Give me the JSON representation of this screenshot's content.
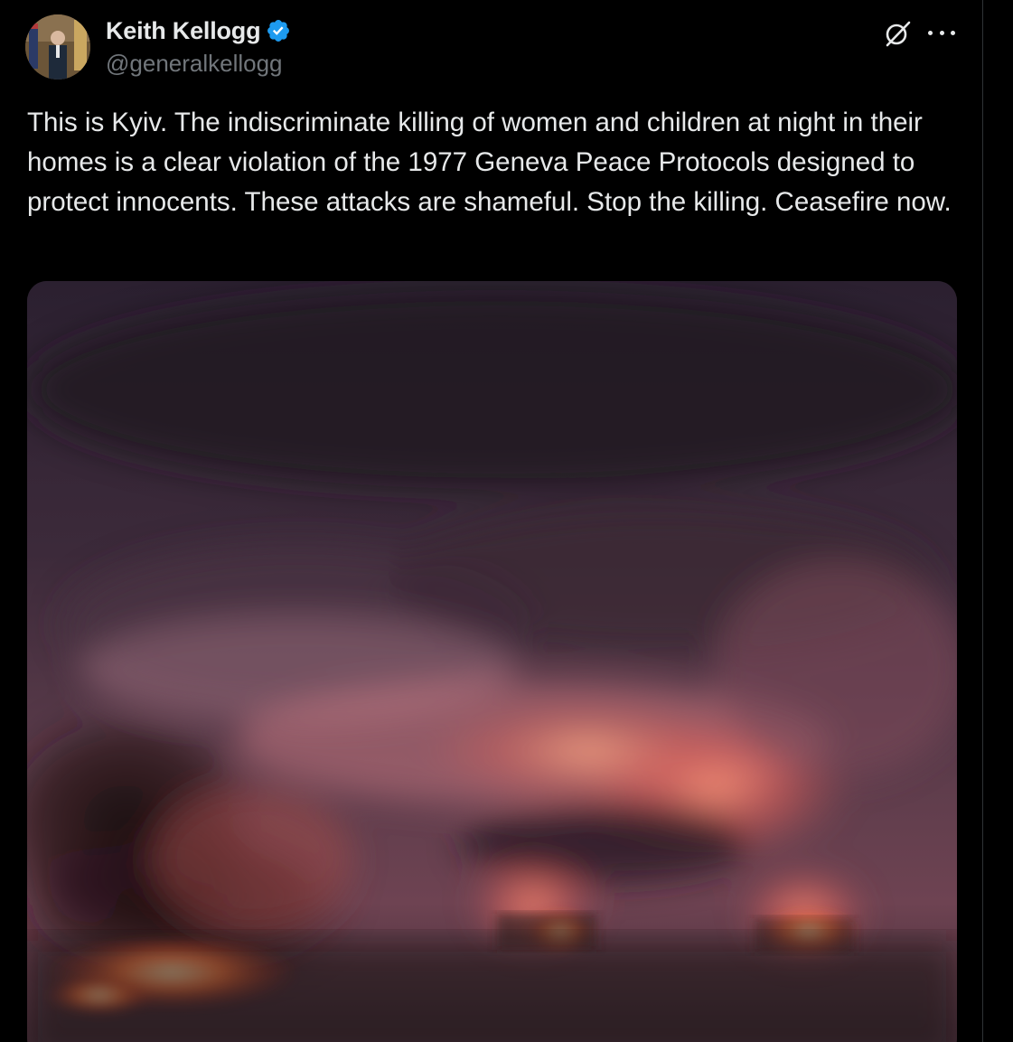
{
  "post": {
    "author": {
      "display_name": "Keith Kellogg",
      "handle": "@generalkellogg",
      "verified": true,
      "verified_color": "#1d9bf0"
    },
    "text": "This is Kyiv. The indiscriminate killing of women and children at night in their homes is a clear violation of the 1977 Geneva Peace Protocols designed to protect innocents. These attacks are shameful. Stop the killing. Ceasefire now.",
    "icons": {
      "grok": "grok-icon",
      "more": "more-options-icon",
      "verified": "verified-badge-icon"
    }
  },
  "theme": {
    "background": "#000000",
    "text_primary": "#e7e9ea",
    "text_secondary": "#71767b"
  }
}
